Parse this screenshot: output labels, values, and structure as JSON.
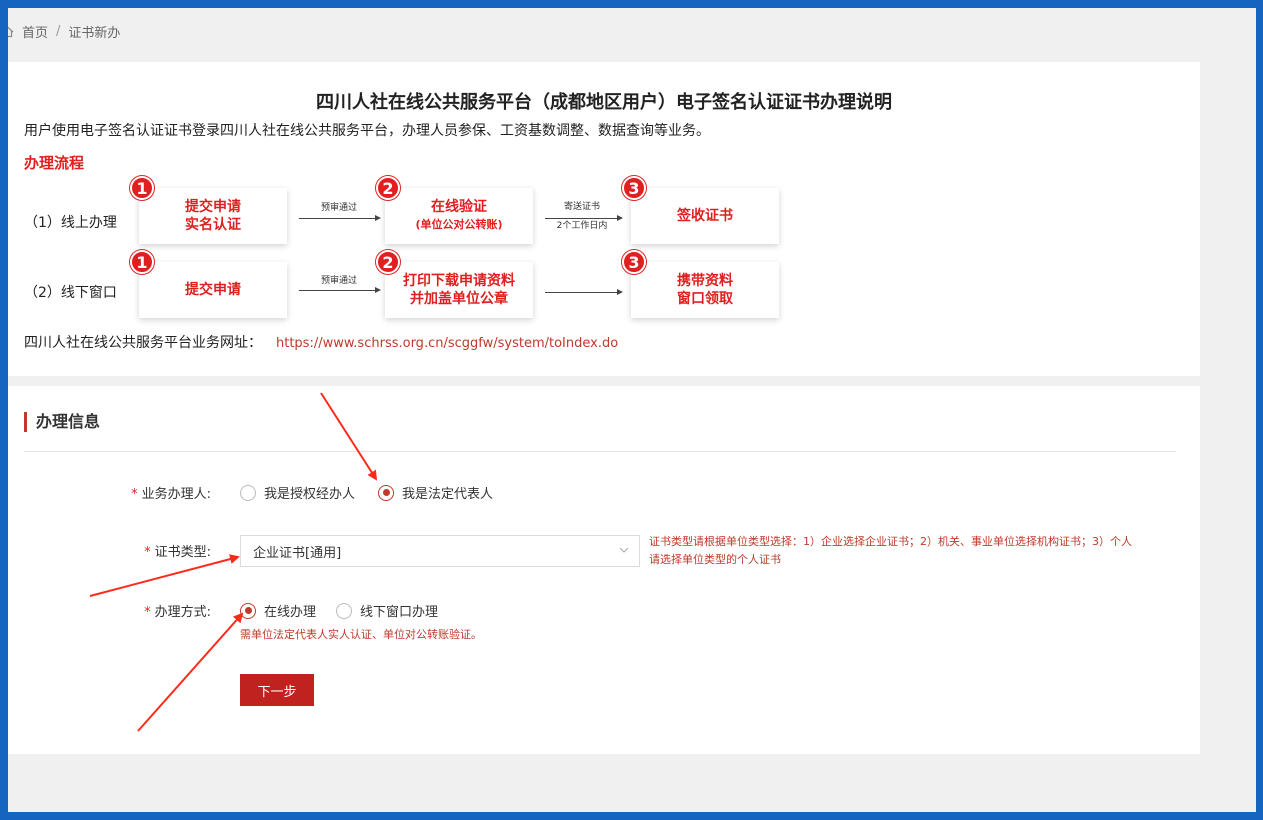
{
  "breadcrumb": {
    "home": "首页",
    "separator": "/",
    "current": "证书新办"
  },
  "intro": {
    "title": "四川人社在线公共服务平台（成都地区用户）电子签名认证证书办理说明",
    "description": "用户使用电子签名认证证书登录四川人社在线公共服务平台，办理人员参保、工资基数调整、数据查询等业务。",
    "flow_title": "办理流程",
    "online": {
      "label": "（1）线上办理",
      "step1": {
        "num": "1",
        "line1": "提交申请",
        "line2": "实名认证"
      },
      "arrow1": {
        "text1": "预审通过"
      },
      "step2": {
        "num": "2",
        "line1": "在线验证",
        "line2": "(单位公对公转账)"
      },
      "arrow2": {
        "text1": "寄送证书",
        "text2": "2个工作日内"
      },
      "step3": {
        "num": "3",
        "line1": "签收证书"
      }
    },
    "offline": {
      "label": "（2）线下窗口",
      "step1": {
        "num": "1",
        "line1": "提交申请"
      },
      "arrow1": {
        "text1": "预审通过"
      },
      "step2": {
        "num": "2",
        "line1": "打印下载申请资料",
        "line2": "并加盖单位公章"
      },
      "step3": {
        "num": "3",
        "line1": "携带资料",
        "line2": "窗口领取"
      }
    },
    "url_label": "四川人社在线公共服务平台业务网址：",
    "url": "https://www.schrss.org.cn/scggfw/system/toIndex.do"
  },
  "form": {
    "section_title": "办理信息",
    "required_mark": "*",
    "handler": {
      "label": "业务办理人:",
      "options": [
        {
          "label": "我是授权经办人",
          "selected": false
        },
        {
          "label": "我是法定代表人",
          "selected": true
        }
      ]
    },
    "cert_type": {
      "label": "证书类型:",
      "value": "企业证书[通用]",
      "hint_line1": "证书类型请根据单位类型选择：1）企业选择企业证书；2）机关、事业单位选择机构证书；3）个人",
      "hint_line2": "请选择单位类型的个人证书"
    },
    "method": {
      "label": "办理方式:",
      "options": [
        {
          "label": "在线办理",
          "selected": true
        },
        {
          "label": "线下窗口办理",
          "selected": false
        }
      ],
      "hint": "需单位法定代表人实人认证、单位对公转账验证。"
    },
    "next_button": "下一步"
  },
  "colors": {
    "frame_border": "#1565c0",
    "accent_red": "#c0392b",
    "annotation_arrow": "#ff2a1a"
  }
}
